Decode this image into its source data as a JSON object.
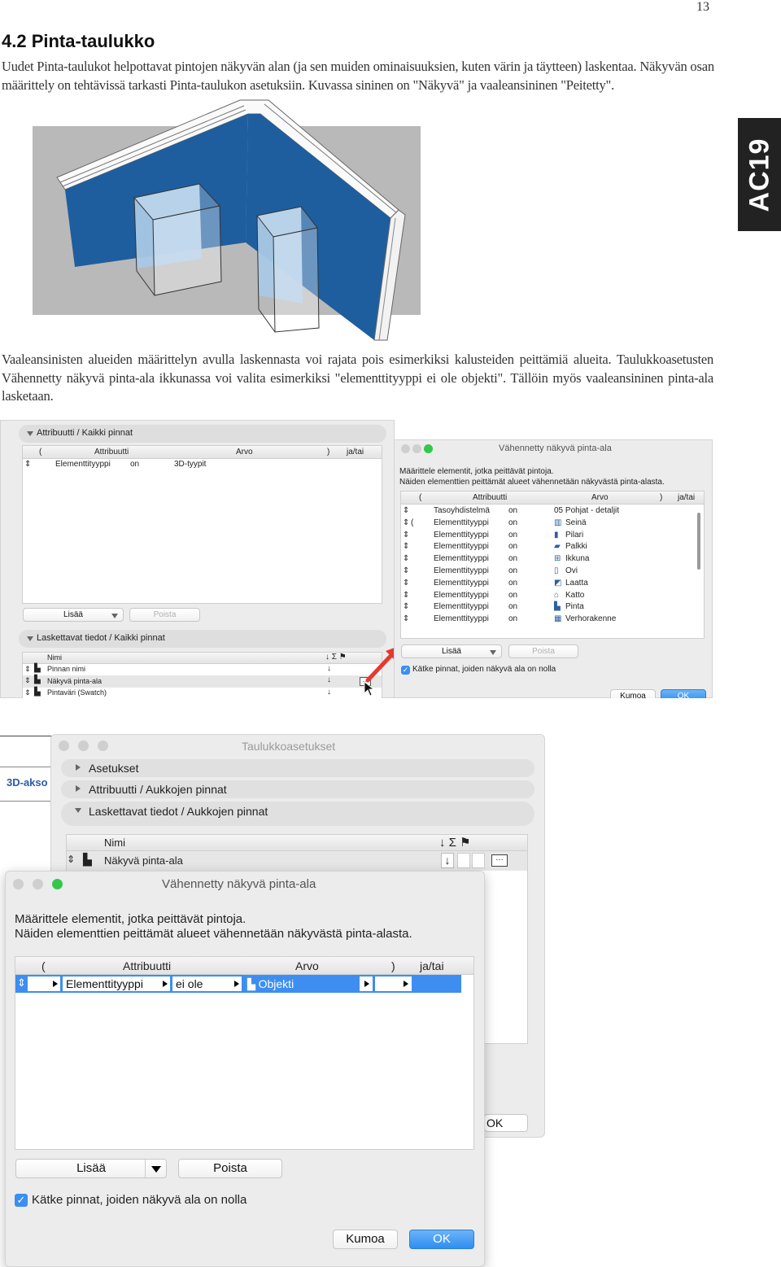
{
  "page_number": "13",
  "heading": "4.2 Pinta-taulukko",
  "intro": "Uudet Pinta-taulukot helpottavat pintojen näkyvän alan (ja sen muiden ominaisuuksien, kuten värin ja täytteen) laskentaa. Näkyvän osan määrittely on tehtävissä tarkasti Pinta-taulukon asetuksiin. Kuvassa sininen on \"Näkyvä\" ja vaaleansininen \"Peitetty\".",
  "side_tab": "AC19",
  "body_text": "Vaaleansinisten alueiden määrittelyn avulla laskennasta voi rajata pois esimerkiksi kalusteiden peittämiä alueita. Taulukkoasetusten Vähennetty näkyvä pinta-ala ikkunassa voi valita esimerkiksi \"elementtityyppi ei ole objekti\". Tällöin myös vaaleansininen pinta-ala lasketaan.",
  "colors": {
    "visible_blue": "#1e5e9e",
    "covered_blue": "#a9c8e6",
    "ok_blue": "#2e8ef0",
    "arrow_red": "#e8382f"
  },
  "shot1": {
    "left_panel": {
      "section1": "Attribuutti /  Kaikki pinnat",
      "cols": [
        "(",
        "Attribuutti",
        "Arvo",
        ")",
        "ja/tai"
      ],
      "row": {
        "attr": "Elementtityyppi",
        "op": "on",
        "value": "3D-tyypit"
      },
      "add": "Lisää",
      "remove": "Poista",
      "section2": "Laskettavat tiedot /  Kaikki pinnat",
      "fields": [
        "Nimi",
        "Pinnan nimi",
        "Näkyvä pinta-ala",
        "Pintaväri (Swatch)"
      ]
    },
    "dialog": {
      "title": "Vähennetty näkyvä pinta-ala",
      "desc1": "Määrittele elementit, jotka peittävät pintoja.",
      "desc2": "Näiden elementtien peittämät alueet vähennetään näkyvästä pinta-alasta.",
      "cols": [
        "(",
        "Attribuutti",
        "Arvo",
        ")",
        "ja/tai"
      ],
      "rows": [
        {
          "paren": "",
          "attr": "Tasoyhdistelmä",
          "op": "on",
          "value": "05 Pohjat - detaljit",
          "icon": ""
        },
        {
          "paren": "(",
          "attr": "Elementtityyppi",
          "op": "on",
          "value": "Seinä",
          "icon": "wall-icon"
        },
        {
          "paren": "",
          "attr": "Elementtityyppi",
          "op": "on",
          "value": "Pilari",
          "icon": "column-icon"
        },
        {
          "paren": "",
          "attr": "Elementtityyppi",
          "op": "on",
          "value": "Palkki",
          "icon": "beam-icon"
        },
        {
          "paren": "",
          "attr": "Elementtityyppi",
          "op": "on",
          "value": "Ikkuna",
          "icon": "window-icon"
        },
        {
          "paren": "",
          "attr": "Elementtityyppi",
          "op": "on",
          "value": "Ovi",
          "icon": "door-icon"
        },
        {
          "paren": "",
          "attr": "Elementtityyppi",
          "op": "on",
          "value": "Laatta",
          "icon": "slab-icon"
        },
        {
          "paren": "",
          "attr": "Elementtityyppi",
          "op": "on",
          "value": "Katto",
          "icon": "roof-icon"
        },
        {
          "paren": "",
          "attr": "Elementtityyppi",
          "op": "on",
          "value": "Pinta",
          "icon": "surface-icon"
        },
        {
          "paren": "",
          "attr": "Elementtityyppi",
          "op": "on",
          "value": "Verhorakenne",
          "icon": "curtain-wall-icon"
        }
      ],
      "add": "Lisää",
      "remove": "Poista",
      "checkbox": "Kätke pinnat, joiden näkyvä ala on nolla",
      "cancel": "Kumoa",
      "ok": "OK"
    }
  },
  "shot2": {
    "back_label": "3D-akso",
    "back_dialog": {
      "title": "Taulukkoasetukset",
      "sections": [
        "Asetukset",
        "Attribuutti /  Aukkojen pinnat",
        "Laskettavat tiedot /  Aukkojen pinnat"
      ],
      "col": "Nimi",
      "row": "Näkyvä pinta-ala",
      "ok_partial": "OK"
    },
    "dialog": {
      "title": "Vähennetty näkyvä pinta-ala",
      "desc1": "Määrittele elementit, jotka peittävät pintoja.",
      "desc2": "Näiden elementtien peittämät alueet vähennetään näkyvästä pinta-alasta.",
      "cols": [
        "(",
        "Attribuutti",
        "Arvo",
        ")",
        "ja/tai"
      ],
      "row": {
        "attr": "Elementtityyppi",
        "op": "ei ole",
        "value": "Objekti"
      },
      "add": "Lisää",
      "remove": "Poista",
      "checkbox": "Kätke pinnat, joiden näkyvä ala on nolla",
      "cancel": "Kumoa",
      "ok": "OK"
    }
  }
}
